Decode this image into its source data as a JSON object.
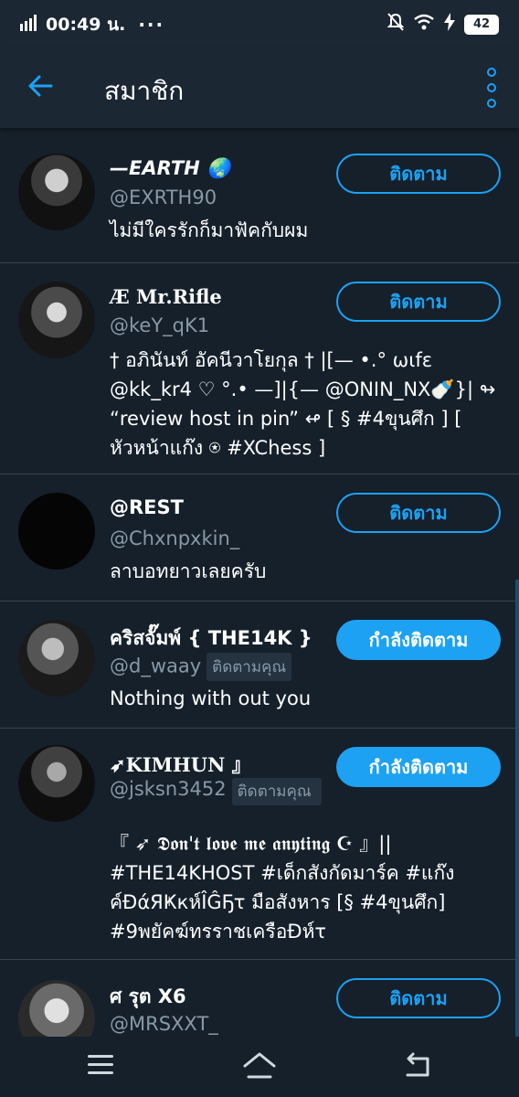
{
  "status": {
    "time": "00:49 น.",
    "signal": "H",
    "dots": "···",
    "battery": "42"
  },
  "header": {
    "title": "สมาชิก"
  },
  "users": [
    {
      "name": "—EARTH 🌏",
      "handle": "@EXRTH90",
      "follows_you": "",
      "bio": "ไม่มีใครรักก็มาฟัคกับผม",
      "button": "ติดตาม",
      "following": false
    },
    {
      "name": "Æ Mr.Rifle",
      "handle": "@keY_qK1",
      "follows_you": "",
      "bio": "† อภินันท์ อัคนีวาโยกุล † |[— •.° ωιfɛ @kk_kr4 ♡ °.• —]|{— @ONIN_NX🍼}| ↬ “review host in pin” ↫ [ § #4ขุนศึก ] [ หัวหน้าแก๊ง ⍟ #XChess ]",
      "button": "ติดตาม",
      "following": false
    },
    {
      "name": "@REST",
      "handle": "@Chxnpxkin_",
      "follows_you": "",
      "bio": "ลาบอทยาวเลยครับ",
      "button": "ติดตาม",
      "following": false
    },
    {
      "name": "คริสจั๊มพ์ { THE14K }",
      "handle": "@d_waay",
      "follows_you": "ติดตามคุณ",
      "bio": "Nothing with out you",
      "button": "กำลังติดตาม",
      "following": true
    },
    {
      "name": "➶KIMHUN 』",
      "handle": "@jsksn3452",
      "follows_you": "ติดตามคุณ",
      "bio": "『 ➶ 𝕯𝖔𝖓'𝖙 𝖑𝖔𝖛𝖊 𝖒𝖊 𝖆𝖓𝖞𝖙𝖎𝖓𝖌 ☪ 』|| #THE14KHOST #เด็กสังกัดมาร์ค #แก๊งค์ĐάЯҜкห์ÎĜҔτ มือสังหาร [§ #4ขุนศึก] #9พยัคฆ์ทรราชเครือĐห์τ",
      "button": "กำลังติดตาม",
      "following": true
    },
    {
      "name": "ศ รุต X6",
      "handle": "@MRSXXT_",
      "follows_you": "",
      "bio": "",
      "button": "ติดตาม",
      "following": false
    }
  ],
  "icons": {
    "back": "arrow-left-icon",
    "more": "more-vertical-icon",
    "nav_menu": "menu-icon",
    "nav_home": "home-icon",
    "nav_back": "return-icon"
  },
  "colors": {
    "background": "#15202b",
    "accent": "#1da1f2",
    "secondary_text": "#8899a6",
    "divider": "#38444d"
  }
}
